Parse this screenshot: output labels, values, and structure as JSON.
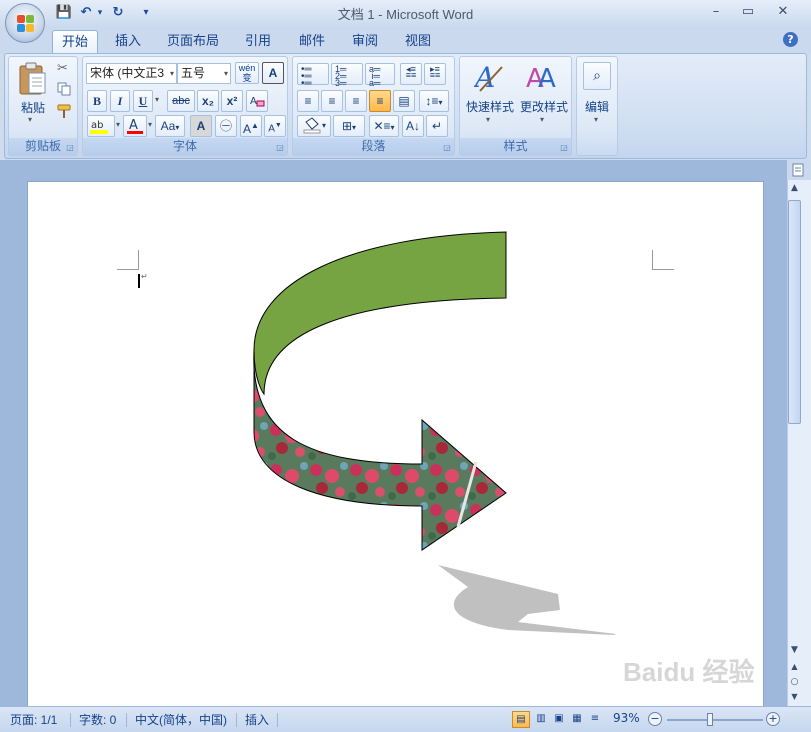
{
  "window": {
    "title": "文档 1 - Microsoft Word",
    "minimize": "–",
    "restore": "▭",
    "close": "✕"
  },
  "qat": {
    "save": "💾",
    "undo": "↶",
    "redo": "↻",
    "customize": "▾"
  },
  "tabs": [
    "开始",
    "插入",
    "页面布局",
    "引用",
    "邮件",
    "审阅",
    "视图"
  ],
  "active_tab": "开始",
  "help": "?",
  "ribbon": {
    "clipboard": {
      "label": "剪贴板",
      "paste": "粘贴"
    },
    "font": {
      "label": "字体",
      "font_name": "宋体 (中文正3",
      "font_size": "五号",
      "bold": "B",
      "italic": "I",
      "underline": "U",
      "strike": "abc",
      "subscript": "x₂",
      "superscript": "x²",
      "phonetic": "wén",
      "change_case": "Aa",
      "grow": "A",
      "shrink": "A"
    },
    "paragraph": {
      "label": "段落"
    },
    "styles": {
      "label": "样式",
      "quick_styles": "快速样式",
      "change_styles": "更改样式"
    },
    "editing": {
      "label": "编辑"
    }
  },
  "colors": {
    "arrow_fill": "#76a442",
    "shadow": "#c0c0c0",
    "highlight": "#ffff00",
    "font_color": "#ff0000"
  },
  "statusbar": {
    "page": "页面: 1/1",
    "words": "字数: 0",
    "language": "中文(简体，中国)",
    "mode": "插入",
    "zoom": "93%"
  },
  "watermark": "Baidu 经验"
}
